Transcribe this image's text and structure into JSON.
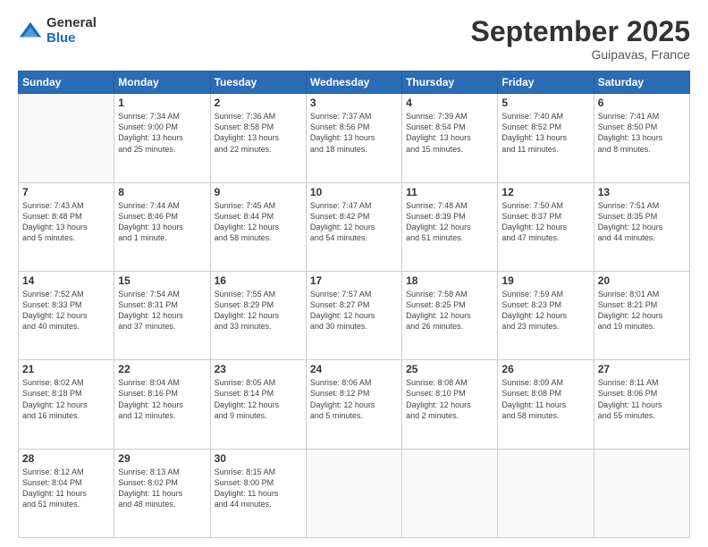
{
  "header": {
    "logo_general": "General",
    "logo_blue": "Blue",
    "month_title": "September 2025",
    "location": "Guipavas, France"
  },
  "weekdays": [
    "Sunday",
    "Monday",
    "Tuesday",
    "Wednesday",
    "Thursday",
    "Friday",
    "Saturday"
  ],
  "weeks": [
    [
      {
        "day": "",
        "info": ""
      },
      {
        "day": "1",
        "info": "Sunrise: 7:34 AM\nSunset: 9:00 PM\nDaylight: 13 hours\nand 25 minutes."
      },
      {
        "day": "2",
        "info": "Sunrise: 7:36 AM\nSunset: 8:58 PM\nDaylight: 13 hours\nand 22 minutes."
      },
      {
        "day": "3",
        "info": "Sunrise: 7:37 AM\nSunset: 8:56 PM\nDaylight: 13 hours\nand 18 minutes."
      },
      {
        "day": "4",
        "info": "Sunrise: 7:39 AM\nSunset: 8:54 PM\nDaylight: 13 hours\nand 15 minutes."
      },
      {
        "day": "5",
        "info": "Sunrise: 7:40 AM\nSunset: 8:52 PM\nDaylight: 13 hours\nand 11 minutes."
      },
      {
        "day": "6",
        "info": "Sunrise: 7:41 AM\nSunset: 8:50 PM\nDaylight: 13 hours\nand 8 minutes."
      }
    ],
    [
      {
        "day": "7",
        "info": "Sunrise: 7:43 AM\nSunset: 8:48 PM\nDaylight: 13 hours\nand 5 minutes."
      },
      {
        "day": "8",
        "info": "Sunrise: 7:44 AM\nSunset: 8:46 PM\nDaylight: 13 hours\nand 1 minute."
      },
      {
        "day": "9",
        "info": "Sunrise: 7:45 AM\nSunset: 8:44 PM\nDaylight: 12 hours\nand 58 minutes."
      },
      {
        "day": "10",
        "info": "Sunrise: 7:47 AM\nSunset: 8:42 PM\nDaylight: 12 hours\nand 54 minutes."
      },
      {
        "day": "11",
        "info": "Sunrise: 7:48 AM\nSunset: 8:39 PM\nDaylight: 12 hours\nand 51 minutes."
      },
      {
        "day": "12",
        "info": "Sunrise: 7:50 AM\nSunset: 8:37 PM\nDaylight: 12 hours\nand 47 minutes."
      },
      {
        "day": "13",
        "info": "Sunrise: 7:51 AM\nSunset: 8:35 PM\nDaylight: 12 hours\nand 44 minutes."
      }
    ],
    [
      {
        "day": "14",
        "info": "Sunrise: 7:52 AM\nSunset: 8:33 PM\nDaylight: 12 hours\nand 40 minutes."
      },
      {
        "day": "15",
        "info": "Sunrise: 7:54 AM\nSunset: 8:31 PM\nDaylight: 12 hours\nand 37 minutes."
      },
      {
        "day": "16",
        "info": "Sunrise: 7:55 AM\nSunset: 8:29 PM\nDaylight: 12 hours\nand 33 minutes."
      },
      {
        "day": "17",
        "info": "Sunrise: 7:57 AM\nSunset: 8:27 PM\nDaylight: 12 hours\nand 30 minutes."
      },
      {
        "day": "18",
        "info": "Sunrise: 7:58 AM\nSunset: 8:25 PM\nDaylight: 12 hours\nand 26 minutes."
      },
      {
        "day": "19",
        "info": "Sunrise: 7:59 AM\nSunset: 8:23 PM\nDaylight: 12 hours\nand 23 minutes."
      },
      {
        "day": "20",
        "info": "Sunrise: 8:01 AM\nSunset: 8:21 PM\nDaylight: 12 hours\nand 19 minutes."
      }
    ],
    [
      {
        "day": "21",
        "info": "Sunrise: 8:02 AM\nSunset: 8:18 PM\nDaylight: 12 hours\nand 16 minutes."
      },
      {
        "day": "22",
        "info": "Sunrise: 8:04 AM\nSunset: 8:16 PM\nDaylight: 12 hours\nand 12 minutes."
      },
      {
        "day": "23",
        "info": "Sunrise: 8:05 AM\nSunset: 8:14 PM\nDaylight: 12 hours\nand 9 minutes."
      },
      {
        "day": "24",
        "info": "Sunrise: 8:06 AM\nSunset: 8:12 PM\nDaylight: 12 hours\nand 5 minutes."
      },
      {
        "day": "25",
        "info": "Sunrise: 8:08 AM\nSunset: 8:10 PM\nDaylight: 12 hours\nand 2 minutes."
      },
      {
        "day": "26",
        "info": "Sunrise: 8:09 AM\nSunset: 8:08 PM\nDaylight: 11 hours\nand 58 minutes."
      },
      {
        "day": "27",
        "info": "Sunrise: 8:11 AM\nSunset: 8:06 PM\nDaylight: 11 hours\nand 55 minutes."
      }
    ],
    [
      {
        "day": "28",
        "info": "Sunrise: 8:12 AM\nSunset: 8:04 PM\nDaylight: 11 hours\nand 51 minutes."
      },
      {
        "day": "29",
        "info": "Sunrise: 8:13 AM\nSunset: 8:02 PM\nDaylight: 11 hours\nand 48 minutes."
      },
      {
        "day": "30",
        "info": "Sunrise: 8:15 AM\nSunset: 8:00 PM\nDaylight: 11 hours\nand 44 minutes."
      },
      {
        "day": "",
        "info": ""
      },
      {
        "day": "",
        "info": ""
      },
      {
        "day": "",
        "info": ""
      },
      {
        "day": "",
        "info": ""
      }
    ]
  ]
}
